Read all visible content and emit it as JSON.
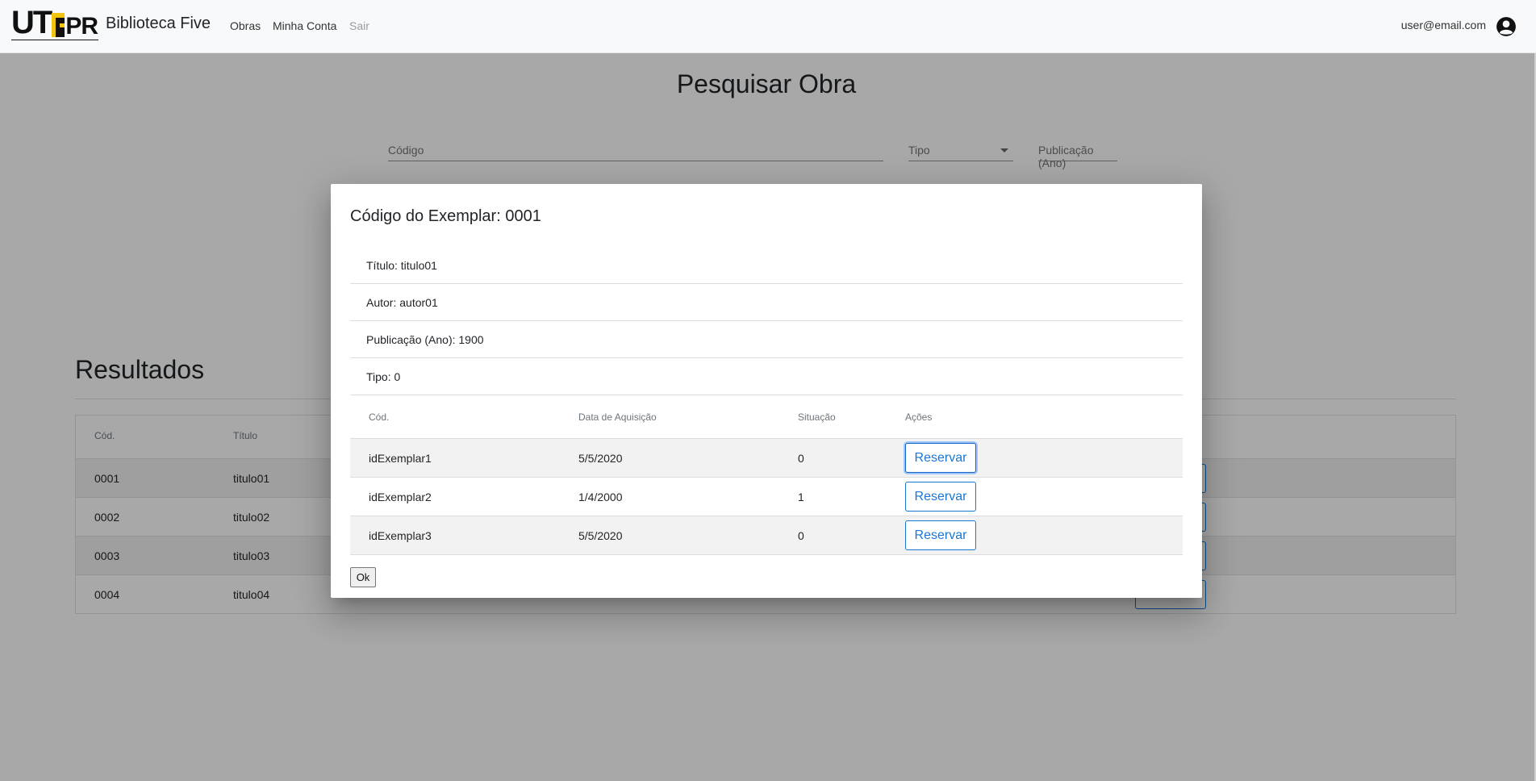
{
  "navbar": {
    "logo_text": "UTFPR",
    "brand": "Biblioteca Five",
    "links": [
      "Obras",
      "Minha Conta",
      "Sair"
    ],
    "user_email": "user@email.com",
    "user_icon": "account-circle-icon"
  },
  "search": {
    "title": "Pesquisar Obra",
    "codigo_placeholder": "Código",
    "tipo_placeholder": "Tipo",
    "ano_placeholder": "Publicação (Ano)"
  },
  "results": {
    "title": "Resultados",
    "headers": [
      "Cód.",
      "Título"
    ],
    "rows": [
      {
        "cod": "0001",
        "titulo": "titulo01"
      },
      {
        "cod": "0002",
        "titulo": "titulo02"
      },
      {
        "cod": "0003",
        "titulo": "titulo03"
      },
      {
        "cod": "0004",
        "titulo": "titulo04"
      }
    ]
  },
  "modal": {
    "title": "Código do Exemplar: 0001",
    "info": [
      "Título: titulo01",
      "Autor: autor01",
      "Publicação (Ano): 1900",
      "Tipo: 0"
    ],
    "table_headers": [
      "Cód.",
      "Data de Aquisição",
      "Situação",
      "Ações"
    ],
    "rows": [
      {
        "cod": "idExemplar1",
        "data": "5/5/2020",
        "situacao": "0",
        "action": "Reservar"
      },
      {
        "cod": "idExemplar2",
        "data": "1/4/2000",
        "situacao": "1",
        "action": "Reservar"
      },
      {
        "cod": "idExemplar3",
        "data": "5/5/2020",
        "situacao": "0",
        "action": "Reservar"
      }
    ],
    "ok_label": "Ok"
  },
  "colors": {
    "accent": "#1976d2",
    "backdrop": "rgba(0,0,0,0.34)",
    "navbar_bg": "#f8f9fa"
  }
}
